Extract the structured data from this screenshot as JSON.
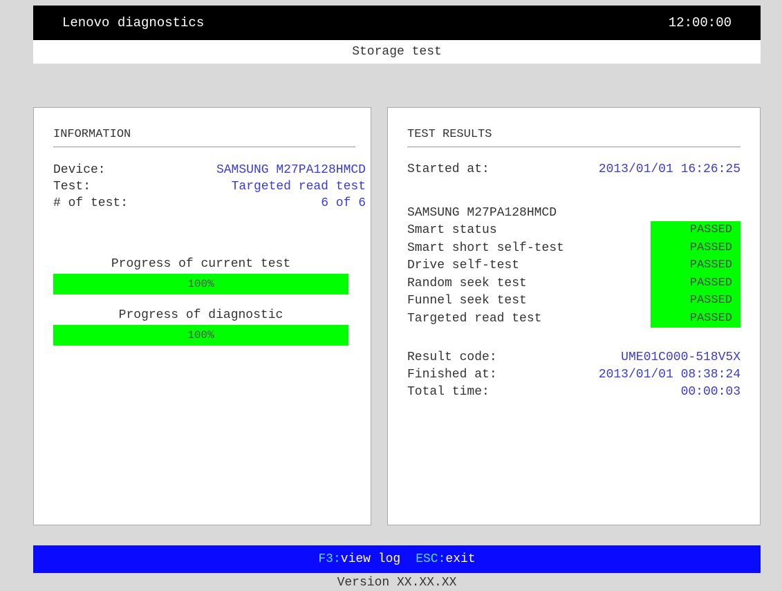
{
  "header": {
    "app_title": "Lenovo diagnostics",
    "clock": "12:00:00",
    "subtitle": "Storage test"
  },
  "information": {
    "title": "INFORMATION",
    "device_label": "Device:",
    "device_value": "SAMSUNG M27PA128HMCD",
    "test_label": "Test:",
    "test_value": "Targeted read test",
    "count_label": "# of test:",
    "count_value": "6 of 6",
    "progress_current_label": "Progress of current test",
    "progress_current_value": "100%",
    "progress_current_fraction": 1.0,
    "progress_diag_label": "Progress of diagnostic",
    "progress_diag_value": "100%",
    "progress_diag_fraction": 1.0
  },
  "results": {
    "title": "TEST RESULTS",
    "started_label": "Started at:",
    "started_value": "2013/01/01 16:26:25",
    "device_name": "SAMSUNG M27PA128HMCD",
    "tests": [
      {
        "name": "Smart status",
        "status": "PASSED"
      },
      {
        "name": "Smart short self-test",
        "status": "PASSED"
      },
      {
        "name": "Drive self-test",
        "status": "PASSED"
      },
      {
        "name": "Random seek test",
        "status": "PASSED"
      },
      {
        "name": "Funnel seek test",
        "status": "PASSED"
      },
      {
        "name": "Targeted read test",
        "status": "PASSED"
      }
    ],
    "result_code_label": "Result code:",
    "result_code_value": "UME01C000-518V5X",
    "finished_label": "Finished at:",
    "finished_value": "2013/01/01 08:38:24",
    "total_label": "Total time:",
    "total_value": "00:00:03"
  },
  "footer": {
    "f3_key": "F3:",
    "f3_action": "view log",
    "esc_key": "ESC:",
    "esc_action": "exit",
    "version": "Version XX.XX.XX"
  },
  "colors": {
    "pass": "#00ff00",
    "value_text": "#3b3bd6",
    "footer_bg": "#0a0aff",
    "key_text": "#55dddd"
  }
}
